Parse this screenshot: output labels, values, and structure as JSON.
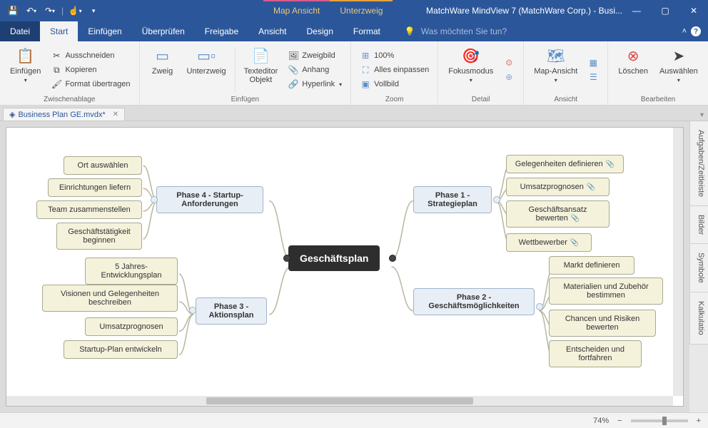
{
  "title": "MatchWare MindView 7 (MatchWare Corp.) - Busi...",
  "titlebar_tabs": {
    "map": "Map Ansicht",
    "uz": "Unterzweig"
  },
  "menubar": {
    "file": "Datei",
    "start": "Start",
    "insert": "Einfügen",
    "review": "Überprüfen",
    "share": "Freigabe",
    "view": "Ansicht",
    "design": "Design",
    "format": "Format",
    "tellme": "Was möchten Sie tun?"
  },
  "ribbon": {
    "paste": "Einfügen",
    "cut": "Ausschneiden",
    "copy": "Kopieren",
    "format_painter": "Format übertragen",
    "clipboard_label": "Zwischenablage",
    "branch": "Zweig",
    "subbranch": "Unterzweig",
    "texteditor": "Texteditor\nObjekt",
    "branchimage": "Zweigbild",
    "attachment": "Anhang",
    "hyperlink": "Hyperlink",
    "insert_label": "Einfügen",
    "zoom100": "100%",
    "fitall": "Alles einpassen",
    "fullscreen": "Vollbild",
    "zoom_label": "Zoom",
    "focus": "Fokusmodus",
    "detail_label": "Detail",
    "mapview": "Map-Ansicht",
    "view_label": "Ansicht",
    "delete": "Löschen",
    "select": "Auswählen",
    "edit_label": "Bearbeiten"
  },
  "doc_tab": "Business Plan GE.mvdx*",
  "side_tabs": [
    "Aufgaben/Zeitleiste",
    "Bilder",
    "Symbole",
    "Kalkulatio"
  ],
  "status": {
    "zoom": "74%"
  },
  "mindmap": {
    "root": "Geschäftsplan",
    "phase4": {
      "title": "Phase 4 - Startup-Anforderungen",
      "children": [
        "Ort auswählen",
        "Einrichtungen liefern",
        "Team zusammenstellen",
        "Geschäftstätigkeit beginnen"
      ]
    },
    "phase3": {
      "title": "Phase 3 - Aktionsplan",
      "children": [
        "5 Jahres-Entwicklungsplan",
        "Visionen und Gelegenheiten beschreiben",
        "Umsatzprognosen",
        "Startup-Plan entwickeln"
      ]
    },
    "phase1": {
      "title": "Phase 1 - Strategieplan",
      "children": [
        "Gelegenheiten definieren",
        "Umsatzprognosen",
        "Geschäftsansatz bewerten",
        "Wettbewerber"
      ]
    },
    "phase2": {
      "title": "Phase 2 - Geschäftsmöglichkeiten",
      "children": [
        "Markt definieren",
        "Materialien und Zubehör bestimmen",
        "Chancen und Risiken bewerten",
        "Entscheiden und fortfahren"
      ]
    }
  }
}
